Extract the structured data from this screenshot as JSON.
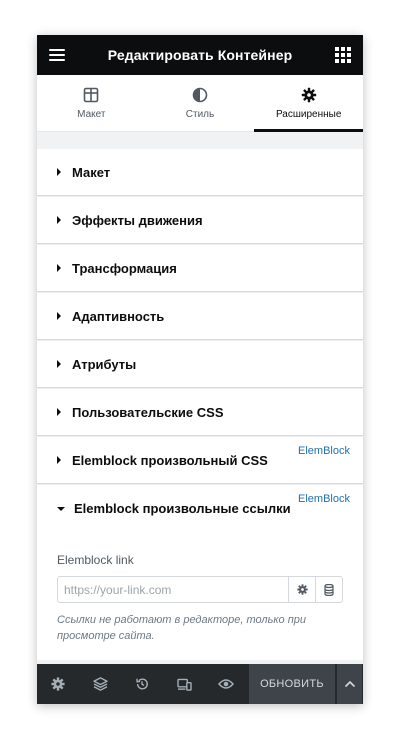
{
  "header": {
    "title": "Редактировать Контейнер",
    "menu_icon": "hamburger-icon",
    "apps_icon": "grid-icon"
  },
  "tabs": [
    {
      "label": "Макет",
      "icon": "layout-icon",
      "active": false
    },
    {
      "label": "Стиль",
      "icon": "contrast-icon",
      "active": false
    },
    {
      "label": "Расширенные",
      "icon": "gear-icon",
      "active": true
    }
  ],
  "sections": [
    {
      "title": "Макет",
      "badge": ""
    },
    {
      "title": "Эффекты движения",
      "badge": ""
    },
    {
      "title": "Трансформация",
      "badge": ""
    },
    {
      "title": "Адаптивность",
      "badge": ""
    },
    {
      "title": "Атрибуты",
      "badge": ""
    },
    {
      "title": "Пользовательские CSS",
      "badge": ""
    },
    {
      "title": "Elemblock произвольный CSS",
      "badge": "ElemBlock"
    }
  ],
  "open_section": {
    "title": "Elemblock произвольные ссылки",
    "badge": "ElemBlock",
    "field_label": "Elemblock link",
    "placeholder": "https://your-link.com",
    "value": "",
    "hint": "Ссылки не работают в редакторе, только при просмотре сайта."
  },
  "footer": {
    "update_label": "ОБНОВИТЬ",
    "icons": [
      "gear-icon",
      "layers-icon",
      "history-icon",
      "responsive-icon",
      "eye-icon"
    ]
  },
  "colors": {
    "header_bg": "#0c0d0e",
    "footer_bg": "#26292c",
    "badge": "#2271b1"
  }
}
